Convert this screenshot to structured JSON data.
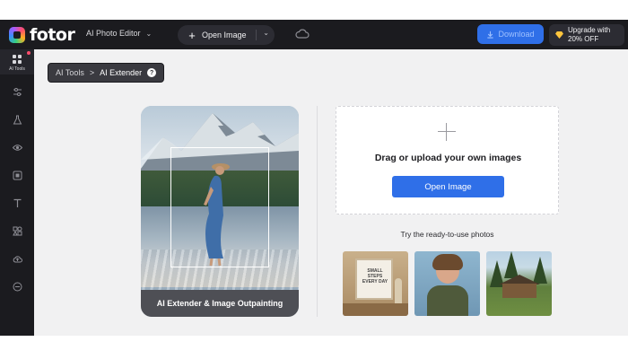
{
  "topbar": {
    "logo_text": "fotor",
    "editor_label": "AI Photo Editor",
    "open_image_label": "Open Image",
    "download_label": "Download",
    "upgrade_line1": "Upgrade with",
    "upgrade_line2": "20% OFF"
  },
  "sidebar": {
    "active_label": "AI Tools",
    "items": [
      "ai-tools",
      "adjust",
      "beauty",
      "effects",
      "frames",
      "text",
      "elements",
      "cloud-upload",
      "more"
    ]
  },
  "breadcrumb": {
    "parent": "AI Tools",
    "separator": ">",
    "current": "AI Extender"
  },
  "preview": {
    "caption": "AI Extender & Image Outpainting"
  },
  "upload": {
    "title": "Drag or upload your own images",
    "button_label": "Open Image"
  },
  "samples": {
    "label": "Try the ready-to-use photos",
    "poster_text": "SMALL STEPS EVERY DAY"
  },
  "colors": {
    "accent": "#2f6fe8",
    "topbar_bg": "#1b1b1f",
    "canvas_bg": "#f1f1f2"
  }
}
